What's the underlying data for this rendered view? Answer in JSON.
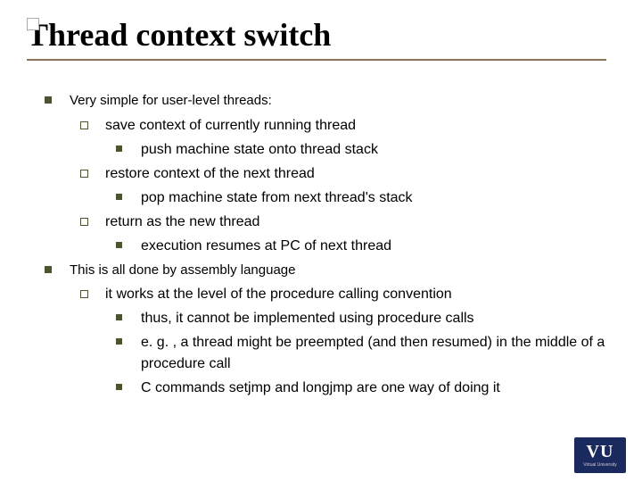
{
  "title": "Thread context switch",
  "b1": {
    "text": "Very simple for user-level threads:",
    "sub": [
      {
        "text": "save context of currently running thread",
        "sub": [
          "push machine state onto thread stack"
        ]
      },
      {
        "text": "restore context of the next thread",
        "sub": [
          "pop machine state from next thread's stack"
        ]
      },
      {
        "text": "return as the new thread",
        "sub": [
          "execution resumes at PC of next thread"
        ]
      }
    ]
  },
  "b2": {
    "text": "This is all done by assembly language",
    "sub": [
      {
        "text": "it works at the level of the procedure calling convention",
        "sub": [
          "thus, it cannot be implemented using procedure calls",
          "e. g. , a thread might be preempted (and then resumed) in the middle of a procedure call",
          "C commands setjmp and longjmp are one way of doing it"
        ]
      }
    ]
  },
  "logo": {
    "main": "VU",
    "sub": "Virtual University"
  }
}
